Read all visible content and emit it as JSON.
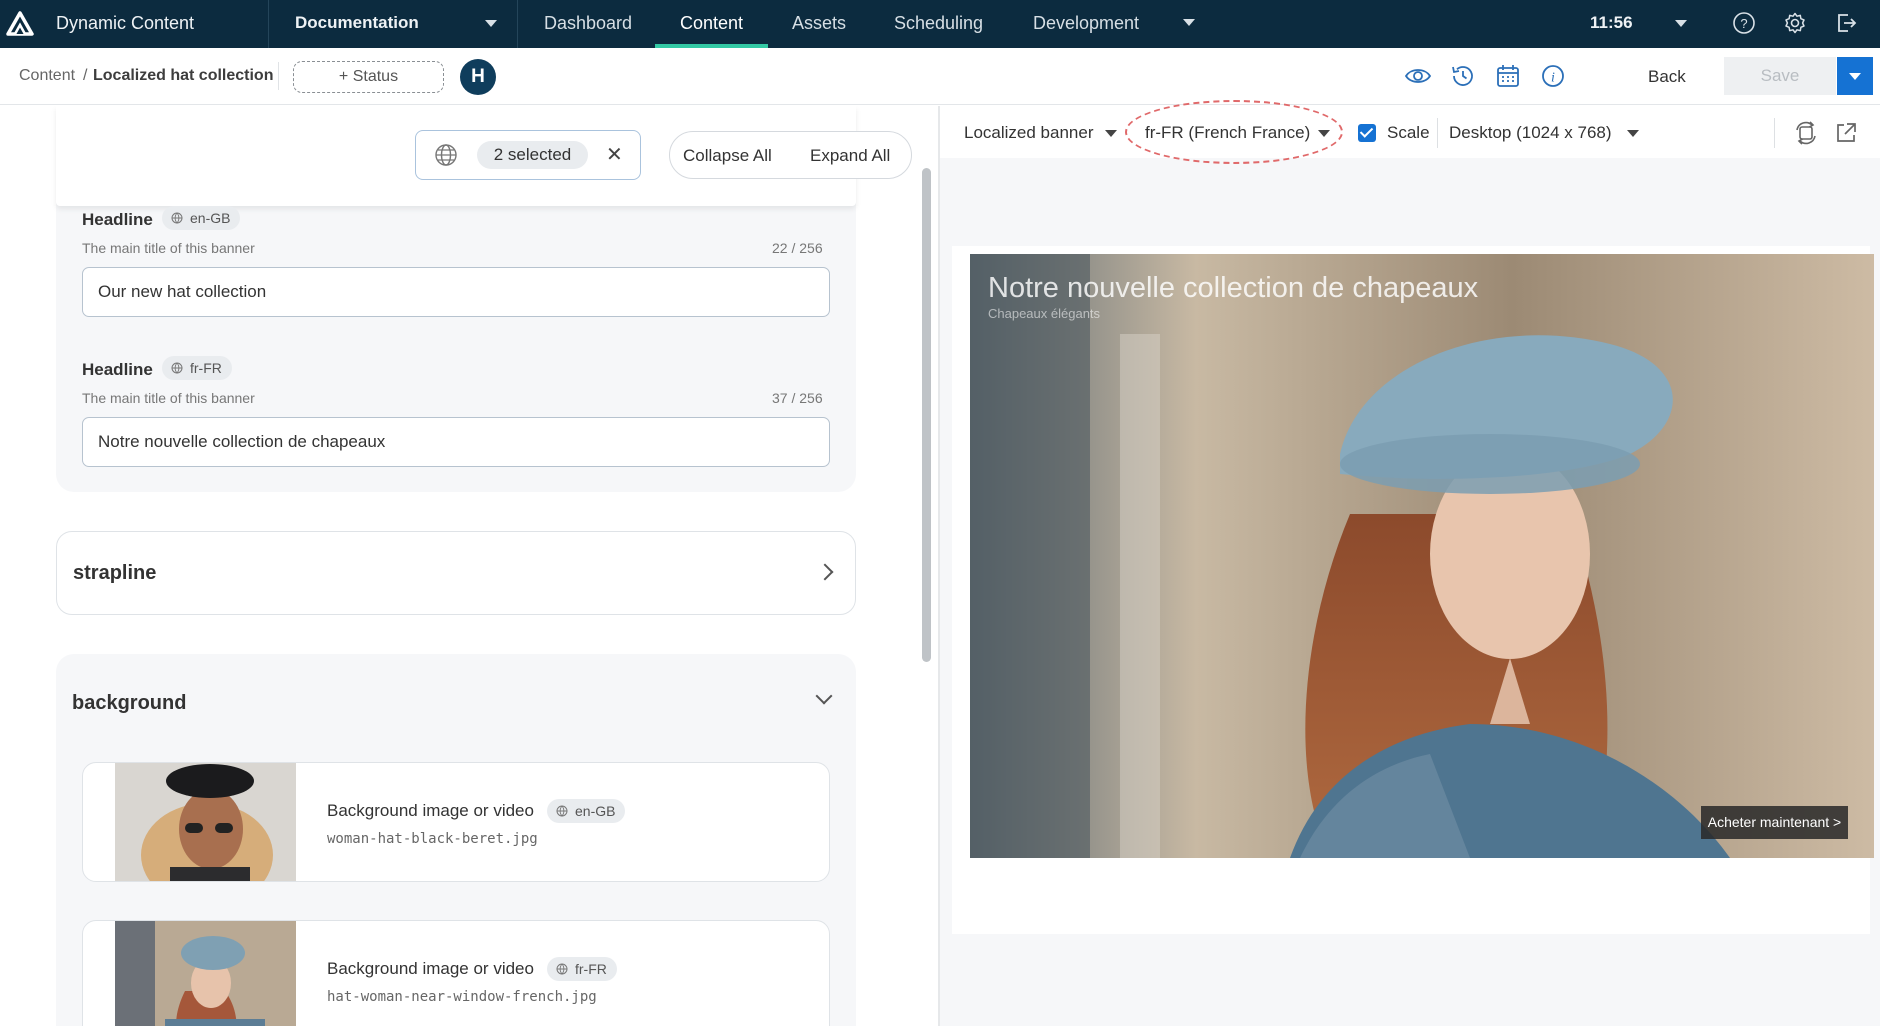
{
  "topbar": {
    "app_title": "Dynamic Content",
    "hub": "Documentation",
    "nav": [
      "Dashboard",
      "Content",
      "Assets",
      "Scheduling",
      "Development"
    ],
    "active_nav": "Content",
    "clock": "11:56"
  },
  "subbar": {
    "breadcrumb_root": "Content",
    "breadcrumb_sep": "/",
    "breadcrumb_current": "Localized hat collection",
    "status_button": "+ Status",
    "avatar_initial": "H",
    "back_label": "Back",
    "save_label": "Save"
  },
  "editor": {
    "locale_filter_label": "2 selected",
    "collapse_all": "Collapse All",
    "expand_all": "Expand All",
    "fields": [
      {
        "label": "Headline",
        "locale": "en-GB",
        "hint": "The main title of this banner",
        "count": "22 / 256",
        "value": "Our new hat collection"
      },
      {
        "label": "Headline",
        "locale": "fr-FR",
        "hint": "The main title of this banner",
        "count": "37 / 256",
        "value": "Notre nouvelle collection de chapeaux"
      }
    ],
    "strapline_title": "strapline",
    "background_title": "background",
    "media": [
      {
        "label": "Background image or video",
        "locale": "en-GB",
        "file": "woman-hat-black-beret.jpg"
      },
      {
        "label": "Background image or video",
        "locale": "fr-FR",
        "file": "hat-woman-near-window-french.jpg"
      }
    ]
  },
  "preview": {
    "template": "Localized banner",
    "locale": "fr-FR (French France)",
    "scale_label": "Scale",
    "scale_checked": true,
    "device": "Desktop (1024 x 768)",
    "banner_headline": "Notre nouvelle collection de chapeaux",
    "banner_sub": "Chapeaux élégants",
    "banner_cta": "Acheter maintenant >"
  },
  "colors": {
    "nav_bg": "#0c2b3f",
    "nav_active_underline": "#33c9a4",
    "primary_blue": "#1572d3",
    "highlight_ellipse": "#e0696a"
  },
  "icons": [
    "logo-icon",
    "caret-down-icon",
    "help-icon",
    "gear-icon",
    "logout-icon",
    "eye-icon",
    "history-icon",
    "calendar-icon",
    "info-icon",
    "globe-icon",
    "close-icon",
    "chevron-right-icon",
    "chevron-down-icon",
    "refresh-icon",
    "external-link-icon"
  ]
}
